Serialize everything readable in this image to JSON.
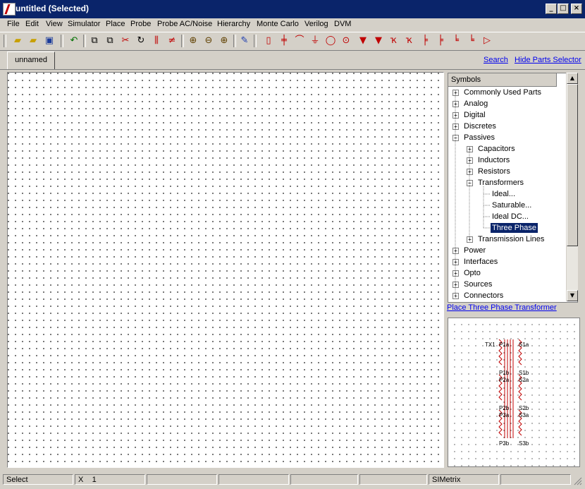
{
  "window": {
    "title": "untitled (Selected)"
  },
  "menu": [
    "File",
    "Edit",
    "View",
    "Simulator",
    "Place",
    "Probe",
    "Probe AC/Noise",
    "Hierarchy",
    "Monte Carlo",
    "Verilog",
    "DVM"
  ],
  "toolbar_icons": [
    "open-folder-icon",
    "open-icon",
    "save-icon",
    "undo-icon",
    "copy-icon",
    "paste-icon",
    "cut-icon",
    "rotate-icon",
    "mirror-icon",
    "flip-icon",
    "zoom-fit-icon",
    "zoom-out-icon",
    "zoom-in-icon",
    "pencil-icon",
    "resistor-icon",
    "capacitor-icon",
    "inductor-icon",
    "ground-icon",
    "voltage-source-icon",
    "current-source-icon",
    "diode-icon",
    "zener-icon",
    "npn-icon",
    "pnp-icon",
    "nmos-icon",
    "pmos-icon",
    "njfet-icon",
    "pjfet-icon",
    "opamp-icon"
  ],
  "tabs": {
    "unnamed": "unnamed"
  },
  "links": {
    "search": "Search",
    "hide_parts": "Hide Parts Selector",
    "place_part": "Place Three Phase Transformer"
  },
  "tree": {
    "header": "Symbols",
    "items": [
      {
        "label": "Commonly Used Parts"
      },
      {
        "label": "Analog"
      },
      {
        "label": "Digital"
      },
      {
        "label": "Discretes"
      },
      {
        "label": "Passives"
      },
      {
        "label": "Capacitors"
      },
      {
        "label": "Inductors"
      },
      {
        "label": "Resistors"
      },
      {
        "label": "Transformers"
      },
      {
        "label": "Ideal..."
      },
      {
        "label": "Saturable..."
      },
      {
        "label": "Ideal DC..."
      },
      {
        "label": "Three Phase"
      },
      {
        "label": "Transmission Lines"
      },
      {
        "label": "Power"
      },
      {
        "label": "Interfaces"
      },
      {
        "label": "Opto"
      },
      {
        "label": "Sources"
      },
      {
        "label": "Connectors"
      }
    ]
  },
  "preview": {
    "labels": {
      "tx": "TX1",
      "p1a": "P1a",
      "s1a": "S1a",
      "p1b": "P1b",
      "s1b": "S1b",
      "p2a": "P2a",
      "s2a": "S2a",
      "p2b": "P2b",
      "s2b": "S2b",
      "p3a": "P3a",
      "s3a": "S3a",
      "p3b": "P3b",
      "s3b": "S3b"
    },
    "color": "#c00000"
  },
  "status": {
    "mode": "Select",
    "x_label": "X",
    "x_value": "1",
    "app": "SIMetrix"
  }
}
